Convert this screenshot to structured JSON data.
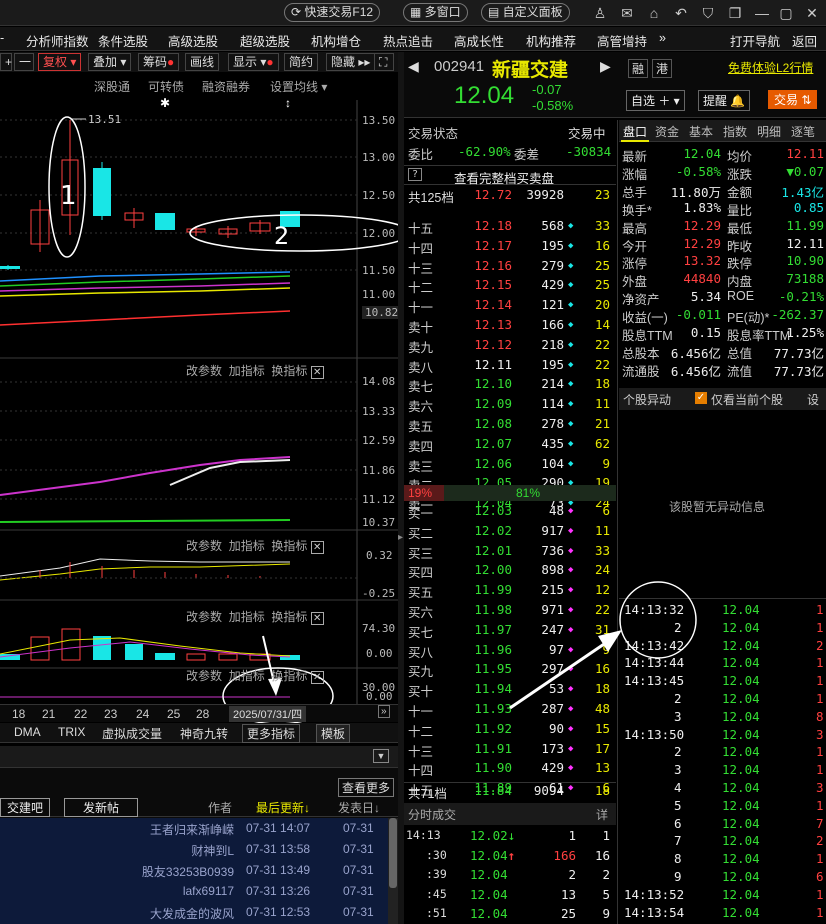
{
  "titlebar": {
    "quick_trade": "快速交易F12",
    "multi_window": "多窗口",
    "custom_panel": "自定义面板"
  },
  "nav": {
    "items": [
      "分析师指数",
      "条件选股",
      "高级选股",
      "超级选股",
      "机构增仓",
      "热点追击",
      "高成长性",
      "机构推荐",
      "高管增持"
    ],
    "more": "»",
    "open_nav": "打开导航",
    "back": "返回"
  },
  "toolbar": {
    "plus": "+",
    "minus": "一",
    "fuquan": "复权",
    "overlay": "叠加",
    "chips": "筹码",
    "draw": "画线",
    "display": "显示",
    "simple": "简约",
    "hide": "隐藏"
  },
  "sublinks": [
    "深股通",
    "可转债",
    "融资融券",
    "设置均线"
  ],
  "chart": {
    "annotation_high": "13.51",
    "axis_main": [
      "13.50",
      "13.00",
      "12.50",
      "12.00",
      "11.50",
      "11.00",
      "10.82"
    ],
    "axis_p2": [
      "14.08",
      "13.33",
      "12.59",
      "11.86",
      "11.12",
      "10.37"
    ],
    "axis_p3": [
      "0.32",
      "-0.25"
    ],
    "axis_p4": [
      "74.30",
      "0.00"
    ],
    "axis_p5": [
      "30.00",
      "0.00"
    ],
    "dates": [
      "18",
      "21",
      "22",
      "23",
      "24",
      "25",
      "28"
    ],
    "date_box": "2025/07/31/四",
    "panel_ctrl": [
      "改参数",
      "加指标",
      "换指标"
    ],
    "callouts": [
      "1",
      "2"
    ]
  },
  "indicator_tabs": [
    "DMA",
    "TRIX",
    "虚拟成交量",
    "神奇九转",
    "更多指标",
    "模板"
  ],
  "forum": {
    "view_more": "查看更多",
    "tab_bar": "交建吧",
    "post_btn": "发新帖",
    "col_author": "作者",
    "col_updated": "最后更新↓",
    "col_date": "发表日↓",
    "rows": [
      {
        "author": "王者归来渐峥嵘",
        "time": "07-31 14:07",
        "date": "07-31"
      },
      {
        "author": "财神到L",
        "time": "07-31 13:58",
        "date": "07-31"
      },
      {
        "author": "股友33253B0939",
        "time": "07-31 13:49",
        "date": "07-31"
      },
      {
        "author": "lafx69117",
        "time": "07-31 13:26",
        "date": "07-31"
      },
      {
        "author": "大发成金的波风",
        "time": "07-31 12:53",
        "date": "07-31"
      }
    ]
  },
  "stock": {
    "code": "002941",
    "name": "新疆交建",
    "price": "12.04",
    "change": "-0.07",
    "change_pct": "-0.58%",
    "tag1": "融",
    "tag2": "港",
    "l2": "免费体验L2行情",
    "add_watch": "自选",
    "remind": "提醒",
    "trade": "交易"
  },
  "book": {
    "status": "交易状态",
    "status_val": "交易中",
    "weibi_label": "委比",
    "weibi": "-62.90%",
    "weicha_label": "委差",
    "weicha": "-30834",
    "view_full": "查看完整档买卖盘",
    "q": "?",
    "sell_total": {
      "label": "共125档",
      "price": "12.72",
      "vol": "39928",
      "cnt": "23"
    },
    "sells": [
      [
        "十五",
        "12.18",
        "568",
        "◆",
        "33"
      ],
      [
        "十四",
        "12.17",
        "195",
        "◆",
        "16"
      ],
      [
        "十三",
        "12.16",
        "279",
        "◆",
        "25"
      ],
      [
        "十二",
        "12.15",
        "429",
        "◆",
        "25"
      ],
      [
        "十一",
        "12.14",
        "121",
        "◆",
        "20"
      ],
      [
        "卖十",
        "12.13",
        "166",
        "◆",
        "14"
      ],
      [
        "卖九",
        "12.12",
        "218",
        "◆",
        "22"
      ],
      [
        "卖八",
        "12.11",
        "195",
        "◆",
        "22"
      ],
      [
        "卖七",
        "12.10",
        "214",
        "◆",
        "18"
      ],
      [
        "卖六",
        "12.09",
        "114",
        "◆",
        "11"
      ],
      [
        "卖五",
        "12.08",
        "278",
        "◆",
        "21"
      ],
      [
        "卖四",
        "12.07",
        "435",
        "◆",
        "62"
      ],
      [
        "卖三",
        "12.06",
        "104",
        "◆",
        "9"
      ],
      [
        "卖二",
        "12.05",
        "290",
        "◆",
        "19"
      ],
      [
        "卖一",
        "12.04",
        "73",
        "◆",
        "24"
      ]
    ],
    "ratio_left": "19%",
    "ratio_mid": "81%",
    "buys": [
      [
        "买一",
        "12.03",
        "48",
        "◆",
        "6"
      ],
      [
        "买二",
        "12.02",
        "917",
        "◆",
        "11"
      ],
      [
        "买三",
        "12.01",
        "736",
        "◆",
        "33"
      ],
      [
        "买四",
        "12.00",
        "898",
        "◆",
        "24"
      ],
      [
        "买五",
        "11.99",
        "215",
        "◆",
        "12"
      ],
      [
        "买六",
        "11.98",
        "971",
        "◆",
        "22"
      ],
      [
        "买七",
        "11.97",
        "247",
        "◆",
        "31"
      ],
      [
        "买八",
        "11.96",
        "97",
        "◆",
        "9"
      ],
      [
        "买九",
        "11.95",
        "297",
        "◆",
        "16"
      ],
      [
        "买十",
        "11.94",
        "53",
        "◆",
        "18"
      ],
      [
        "十一",
        "11.93",
        "287",
        "◆",
        "48"
      ],
      [
        "十二",
        "11.92",
        "90",
        "◆",
        "15"
      ],
      [
        "十三",
        "11.91",
        "173",
        "◆",
        "17"
      ],
      [
        "十四",
        "11.90",
        "429",
        "◆",
        "13"
      ],
      [
        "十五",
        "11.89",
        "61",
        "◆",
        "6"
      ]
    ],
    "buy_total": {
      "label": "共71档",
      "price": "11.84",
      "vol": "9094",
      "cnt": "18"
    },
    "ticks_title": "分时成交",
    "ticks_detail": "详",
    "ticks": [
      [
        "14:13",
        "12.02↓",
        "1",
        "1"
      ],
      [
        ":30",
        "12.04↑",
        "166",
        "16"
      ],
      [
        ":39",
        "12.04",
        "2",
        "2"
      ],
      [
        ":45",
        "12.04",
        "13",
        "5"
      ],
      [
        ":51",
        "12.04",
        "25",
        "9"
      ]
    ]
  },
  "tabs": [
    "盘口",
    "资金",
    "基本",
    "指数",
    "明细",
    "逐笔"
  ],
  "quote": [
    [
      "最新",
      "12.04",
      "均价",
      "12.11"
    ],
    [
      "涨幅",
      "-0.58%",
      "涨跌",
      "▼0.07"
    ],
    [
      "总手",
      "11.80万",
      "金额",
      "1.43亿"
    ],
    [
      "换手*",
      "1.83%",
      "量比",
      "0.85"
    ],
    [
      "最高",
      "12.29",
      "最低",
      "11.99"
    ],
    [
      "今开",
      "12.29",
      "昨收",
      "12.11"
    ],
    [
      "涨停",
      "13.32",
      "跌停",
      "10.90"
    ],
    [
      "外盘",
      "44840",
      "内盘",
      "73188"
    ],
    [
      "净资产",
      "5.34",
      "ROE",
      "-0.21%"
    ],
    [
      "收益(一)",
      "-0.011",
      "PE(动)*",
      "-262.37"
    ],
    [
      "股息TTM",
      "0.15",
      "股息率TTM",
      "1.25%"
    ],
    [
      "总股本",
      "6.456亿",
      "总值",
      "77.73亿"
    ],
    [
      "流通股",
      "6.456亿",
      "流值",
      "77.73亿"
    ]
  ],
  "abnormal": {
    "title": "个股异动",
    "only_current": "仅看当前个股",
    "settings": "设",
    "empty": "该股暂无异动信息"
  },
  "trades": [
    [
      "14:13:32",
      "12.04",
      "1"
    ],
    [
      "2",
      "12.04",
      "1"
    ],
    [
      "14:13:42",
      "12.04",
      "2"
    ],
    [
      "14:13:44",
      "12.04",
      "1"
    ],
    [
      "14:13:45",
      "12.04",
      "1"
    ],
    [
      "2",
      "12.04",
      "1"
    ],
    [
      "3",
      "12.04",
      "8"
    ],
    [
      "14:13:50",
      "12.04",
      "3"
    ],
    [
      "2",
      "12.04",
      "1"
    ],
    [
      "3",
      "12.04",
      "1"
    ],
    [
      "4",
      "12.04",
      "3"
    ],
    [
      "5",
      "12.04",
      "1"
    ],
    [
      "6",
      "12.04",
      "7"
    ],
    [
      "7",
      "12.04",
      "2"
    ],
    [
      "8",
      "12.04",
      "1"
    ],
    [
      "9",
      "12.04",
      "6"
    ],
    [
      "14:13:52",
      "12.04",
      "1"
    ],
    [
      "14:13:54",
      "12.04",
      "1"
    ]
  ]
}
